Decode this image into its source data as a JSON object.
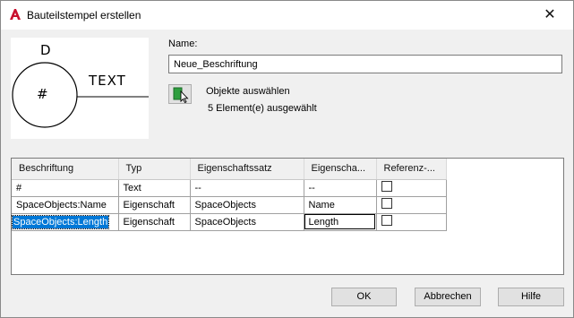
{
  "window": {
    "title": "Bauteilstempel erstellen",
    "close_glyph": "✕",
    "app_icon": "autocad-a-icon",
    "accent_color": "#c8102e"
  },
  "preview": {
    "top_letter": "D",
    "circle_label": "#",
    "side_text": "TEXT"
  },
  "name": {
    "label": "Name:",
    "value": "Neue_Beschriftung"
  },
  "select_objects": {
    "icon": "select-objects-icon",
    "label": "Objekte auswählen",
    "status": "5 Element(e) ausgewählt"
  },
  "grid": {
    "columns": [
      "Beschriftung",
      "Typ",
      "Eigenschaftssatz",
      "Eigenscha...",
      "Referenz-..."
    ],
    "rows": [
      {
        "label": "#",
        "type": "Text",
        "set": "--",
        "property": "--",
        "reference": false
      },
      {
        "label": "SpaceObjects:Name",
        "type": "Eigenschaft",
        "set": "SpaceObjects",
        "property": "Name",
        "reference": false
      },
      {
        "label": "SpaceObjects:Length",
        "type": "Eigenschaft",
        "set": "SpaceObjects",
        "property": "Length",
        "reference": false
      }
    ],
    "selected_row": 2,
    "selection_color": "#0078d7"
  },
  "buttons": {
    "ok": "OK",
    "cancel": "Abbrechen",
    "help": "Hilfe"
  }
}
